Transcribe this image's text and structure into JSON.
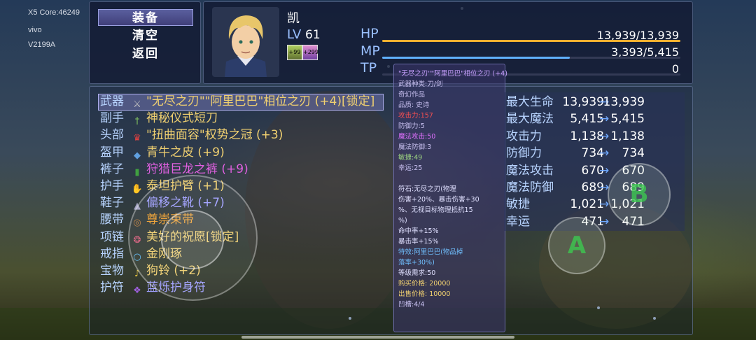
{
  "system": {
    "line1": "X5  Core:46249",
    "line2": "vivo",
    "line3": "V2199A"
  },
  "commands": {
    "equip": "装备",
    "clear": "清空",
    "back": "返回"
  },
  "actor": {
    "name": "凯",
    "level_label": "LV",
    "level": "61",
    "buff1": "+99",
    "buff2": "+299"
  },
  "stats": {
    "hp_label": "HP",
    "hp_value": "13,939/13,939",
    "hp_fraction": 1.0,
    "mp_label": "MP",
    "mp_value": "3,393/5,415",
    "mp_fraction": 0.63,
    "tp_label": "TP",
    "tp_value": "0",
    "tp_fraction": 0.0
  },
  "slots": [
    {
      "label": "武器",
      "icon": "sword-icon",
      "text": "\"无尽之刃\"\"阿里巴巴\"相位之刃 (+4)[锁定]",
      "color": "#f0d070"
    },
    {
      "label": "副手",
      "icon": "dagger-icon",
      "text": "神秘仪式短刀",
      "color": "#f0d070"
    },
    {
      "label": "头部",
      "icon": "crown-icon",
      "text": "\"扭曲面容\"权势之冠 (+3)",
      "color": "#f0d070"
    },
    {
      "label": "盔甲",
      "icon": "armor-icon",
      "text": "青牛之皮 (+9)",
      "color": "#f0d070"
    },
    {
      "label": "裤子",
      "icon": "pants-icon",
      "text": "狩猎巨龙之裤 (+9)",
      "color": "#e060e0"
    },
    {
      "label": "护手",
      "icon": "gauntlet-icon",
      "text": "泰坦护臂 (+1)",
      "color": "#f0d070"
    },
    {
      "label": "鞋子",
      "icon": "boots-icon",
      "text": "偏移之靴 (+7)",
      "color": "#a0a0ff"
    },
    {
      "label": "腰带",
      "icon": "belt-icon",
      "text": "尊崇束带",
      "color": "#f0a030"
    },
    {
      "label": "项链",
      "icon": "necklace-icon",
      "text": "美好的祝愿[锁定]",
      "color": "#f0d070"
    },
    {
      "label": "戒指",
      "icon": "ring-icon",
      "text": "金刚琢",
      "color": "#f0d070"
    },
    {
      "label": "宝物",
      "icon": "bell-icon",
      "text": "狗铃 (+2)",
      "color": "#f0d070"
    },
    {
      "label": "护符",
      "icon": "amulet-icon",
      "text": "蓝烁护身符",
      "color": "#a0a0ff"
    }
  ],
  "tooltip": {
    "title": "\"无尽之刃\"\"阿里巴巴\"相位之刃 (+4)",
    "lines": [
      {
        "t": "武器种类:刀/剑",
        "c": "#c8c0f0"
      },
      {
        "t": "奇幻作品",
        "c": "#c8c0f0"
      },
      {
        "t": "品质: 史诗",
        "c": "#c8c0f0"
      },
      {
        "t": "攻击力:157",
        "c": "#ff5050"
      },
      {
        "t": "防御力:5",
        "c": "#c8c0f0"
      },
      {
        "t": "魔法攻击:50",
        "c": "#e070ff"
      },
      {
        "t": "魔法防御:3",
        "c": "#c8c0f0"
      },
      {
        "t": "敏捷:49",
        "c": "#9ad080"
      },
      {
        "t": "幸运:25",
        "c": "#c8c0f0"
      },
      {
        "t": "",
        "c": "#c8c0f0"
      },
      {
        "t": "符石:无尽之刃(物理",
        "c": "#e0e0ff"
      },
      {
        "t": "伤害+20%、暴击伤害+30",
        "c": "#e0e0ff"
      },
      {
        "t": "%、无视目标物理抵抗15",
        "c": "#e0e0ff"
      },
      {
        "t": "%)",
        "c": "#e0e0ff"
      },
      {
        "t": "命中率+15%",
        "c": "#e0e0ff"
      },
      {
        "t": "暴击率+15%",
        "c": "#e0e0ff"
      },
      {
        "t": "特效:阿里巴巴(物品掉",
        "c": "#70c0ff"
      },
      {
        "t": "落率+30%)",
        "c": "#70c0ff"
      },
      {
        "t": "等级需求:50",
        "c": "#e0e0ff"
      },
      {
        "t": "购买价格: 20000",
        "c": "#f0d070"
      },
      {
        "t": "出售价格: 10000",
        "c": "#f0d070"
      },
      {
        "t": "凹槽:4/4",
        "c": "#c8c0f0"
      }
    ]
  },
  "compare": [
    {
      "name": "最大生命",
      "before": "13,939",
      "after": "13,939",
      "arrow": "→"
    },
    {
      "name": "最大魔法",
      "before": "5,415",
      "after": "5,415",
      "arrow": "→"
    },
    {
      "name": "攻击力",
      "before": "1,138",
      "after": "1,138",
      "arrow": "→"
    },
    {
      "name": "防御力",
      "before": "734",
      "after": "734",
      "arrow": "→"
    },
    {
      "name": "魔法攻击",
      "before": "670",
      "after": "670",
      "arrow": "→"
    },
    {
      "name": "魔法防御",
      "before": "689",
      "after": "689",
      "arrow": "→"
    },
    {
      "name": "敏捷",
      "before": "1,021",
      "after": "1,021",
      "arrow": "→"
    },
    {
      "name": "幸运",
      "before": "471",
      "after": "471",
      "arrow": "→"
    }
  ],
  "buttons": {
    "a": "A",
    "b": "B"
  },
  "colors": {
    "hp": "#f0b030",
    "mp": "#60b0ff",
    "tp": "#60e080",
    "label_blue": "#9ac0ff"
  }
}
